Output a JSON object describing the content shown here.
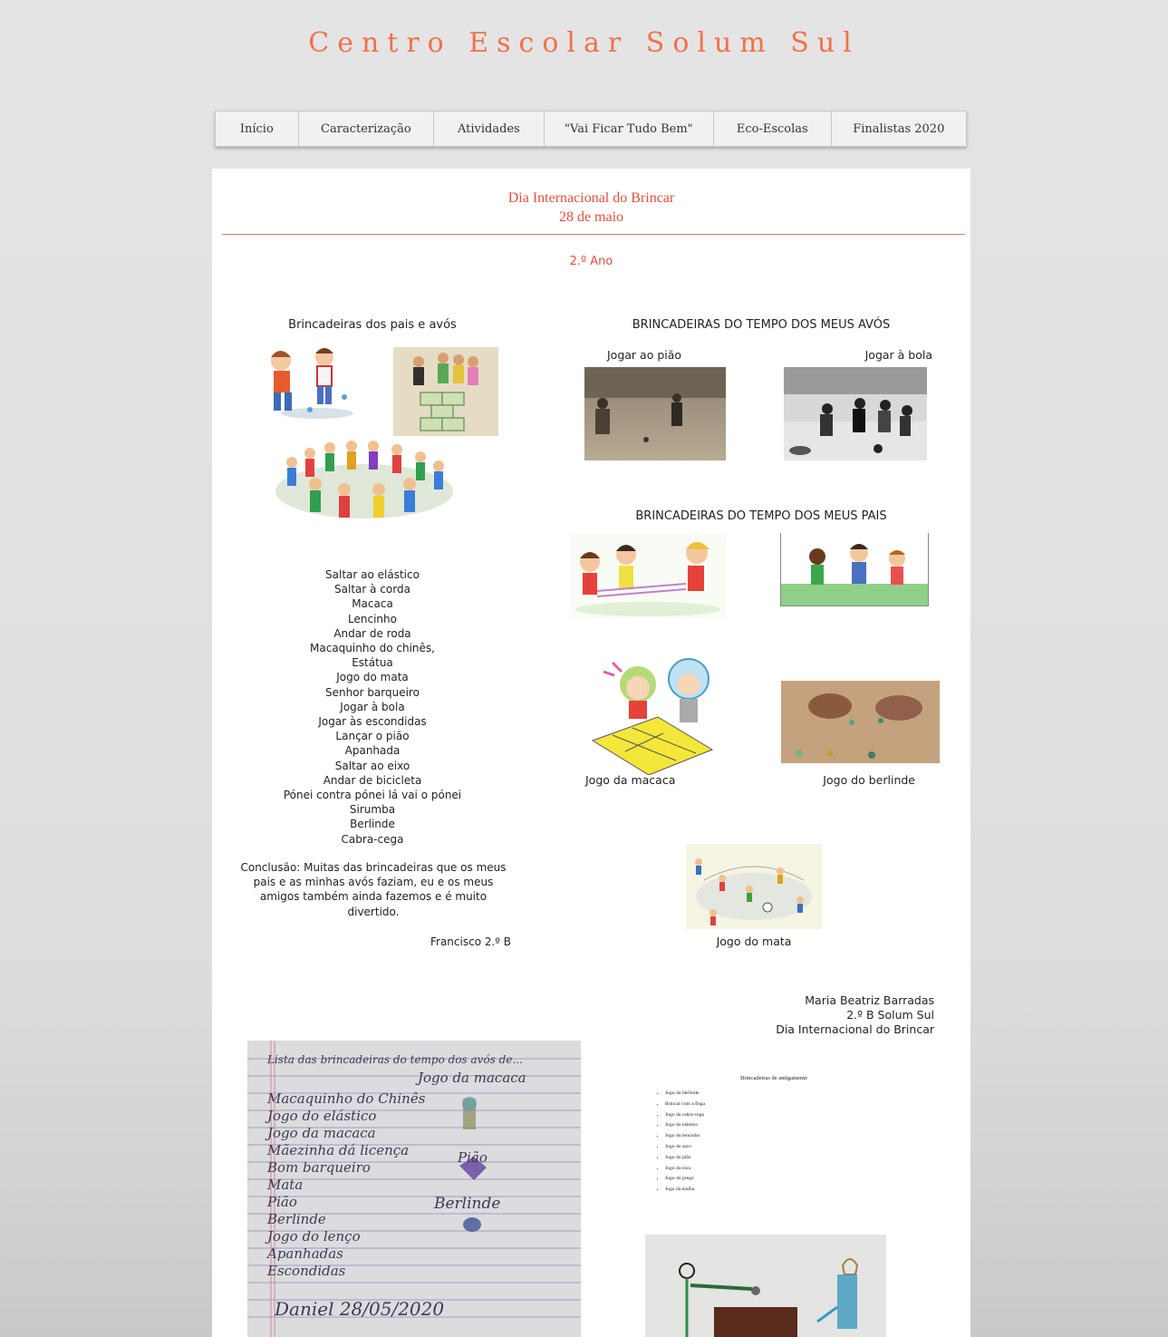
{
  "site": {
    "title": "Centro Escolar Solum Sul"
  },
  "nav": {
    "items": [
      {
        "label": "Início"
      },
      {
        "label": "Caracterização"
      },
      {
        "label": "Atividades"
      },
      {
        "label": "\"Vai Ficar Tudo Bem\""
      },
      {
        "label": "Eco-Escolas"
      },
      {
        "label": "Finalistas 2020"
      }
    ]
  },
  "page": {
    "title_line1": "Dia Internacional do Brincar",
    "title_line2": "28 de maio",
    "subtitle": "2.º Ano"
  },
  "left": {
    "heading": "Brincadeiras dos pais e avós",
    "games": [
      "Saltar ao elástico",
      "Saltar à corda",
      "Macaca",
      "Lencinho",
      "Andar de roda",
      "Macaquinho do chinês,",
      "Estátua",
      "Jogo do mata",
      "Senhor barqueiro",
      "Jogar à bola",
      "Jogar às escondidas",
      "Lançar o pião",
      "Apanhada",
      "Saltar ao eixo",
      "Andar de bicicleta",
      "Pónei contra pónei lá vai o pónei",
      "Sirumba",
      "Berlinde",
      "Cabra-cega"
    ],
    "conclusion": "Conclusão: Muitas das brincadeiras que os meus pais e as minhas avós faziam, eu e os meus amigos também ainda fazemos e é muito divertido.",
    "author": "Francisco 2.º B"
  },
  "right": {
    "heading_avos": "BRINCADEIRAS DO TEMPO DOS MEUS AVÓS",
    "caption_piao": "Jogar ao pião",
    "caption_bola": "Jogar à bola",
    "heading_pais": "BRINCADEIRAS DO TEMPO DOS MEUS PAIS",
    "caption_macaca": "Jogo da macaca",
    "caption_berlinde": "Jogo do berlinde",
    "caption_mata": "Jogo do mata"
  },
  "credit": {
    "name": "Maria Beatriz Barradas",
    "class": "2.º B Solum Sul",
    "event": "Dia Internacional do Brincar"
  },
  "notebook": {
    "header": "Lista das brincadeiras do tempo dos avós de...",
    "side_note": "Jogo da macaca",
    "lines": [
      "Macaquinho do Chinês",
      "Jogo do elástico",
      "Jogo da macaca",
      "Mãezinha dá licença",
      "Bom barqueiro",
      "Mata",
      "Pião",
      "Berlinde",
      "Jogo do lenço",
      "Apanhadas",
      "Escondidas"
    ],
    "label_piao": "Pião",
    "label_berlinde": "Berlinde",
    "signature": "Daniel 28/05/2020"
  },
  "doc": {
    "title": "Brincadeiras de antigamente",
    "items": [
      "Jogo do berlinde",
      "Brincar com a fisga",
      "Jogo da cabra-cega",
      "Jogo do elástico",
      "Jogo do lencinho",
      "Jogo do saco",
      "Jogo do pião",
      "Jogo do eixo",
      "Jogo do prego",
      "Jogo da malha"
    ]
  }
}
